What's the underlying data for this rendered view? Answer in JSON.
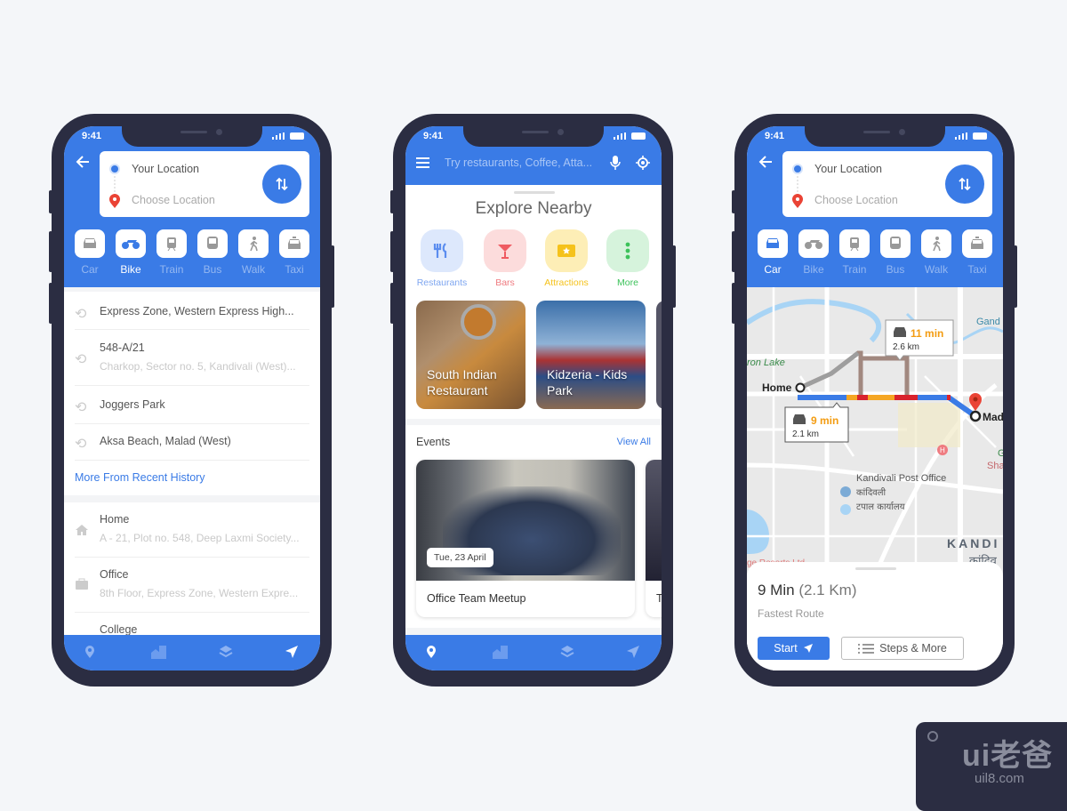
{
  "status": {
    "time": "9:41"
  },
  "colors": {
    "primary": "#3a7be6",
    "frame": "#2b2d42",
    "background": "#f4f6f9",
    "traffic_orange": "#f5a623",
    "traffic_red": "#d9232d",
    "route_alt": "#a1887f"
  },
  "directions": {
    "from": "Your Location",
    "to": "Choose Location",
    "modes": [
      {
        "label": "Car",
        "icon": "car-icon"
      },
      {
        "label": "Bike",
        "icon": "motorbike-icon"
      },
      {
        "label": "Train",
        "icon": "train-icon"
      },
      {
        "label": "Bus",
        "icon": "bus-icon"
      },
      {
        "label": "Walk",
        "icon": "walk-icon"
      },
      {
        "label": "Taxi",
        "icon": "taxi-icon"
      }
    ]
  },
  "history": {
    "items": [
      {
        "title": "Express Zone, Western Express High..."
      },
      {
        "title": "548-A/21",
        "subtitle": "Charkop, Sector no. 5, Kandivali (West)..."
      },
      {
        "title": "Joggers Park"
      },
      {
        "title": "Aksa Beach, Malad (West)"
      }
    ],
    "more_link": "More From Recent History"
  },
  "saved": [
    {
      "title": "Home",
      "subtitle": "A - 21, Plot no. 548, Deep Laxmi Society...",
      "icon": "home-icon"
    },
    {
      "title": "Office",
      "subtitle": "8th Floor, Express Zone, Western Expre...",
      "icon": "briefcase-icon"
    },
    {
      "title": "College"
    }
  ],
  "explore": {
    "search_placeholder": "Try restaurants, Coffee, Atta...",
    "title": "Explore Nearby",
    "categories": [
      {
        "label": "Restaurants",
        "color": "#5b8def",
        "bg": "#dde8fc"
      },
      {
        "label": "Bars",
        "color": "#ef5b62",
        "bg": "#fcdcdc"
      },
      {
        "label": "Attractions",
        "color": "#f5c21b",
        "bg": "#fdeeb6"
      },
      {
        "label": "More",
        "color": "#3cc25a",
        "bg": "#d6f3dc"
      }
    ],
    "places": [
      "South Indian Restaurant",
      "Kidzeria - Kids Park"
    ],
    "events_title": "Events",
    "view_all": "View All",
    "events": [
      {
        "date": "Tue, 23 April",
        "title": "Office Team Meetup"
      },
      {
        "title": "T"
      }
    ]
  },
  "route": {
    "map_labels": {
      "home": "Home",
      "destination": "Mad",
      "lake": "ron Lake",
      "gand": "Gand",
      "post_office": "Kandivali Post Office",
      "post_office_hi1": "कांदिवली",
      "post_office_hi2": "टपाल कार्यालय",
      "area": "KANDI",
      "area_hi": "कांदिव",
      "resort": "ge Resorts Ltd",
      "hospital": "H",
      "sha": "Sha",
      "g": "G"
    },
    "fast": {
      "time": "9 min",
      "distance": "2.1 km"
    },
    "alt": {
      "time": "11 min",
      "distance": "2.6 km"
    },
    "summary_time": "9 Min",
    "summary_distance": "(2.1 Km)",
    "summary_note": "Fastest Route",
    "start": "Start",
    "steps": "Steps & More"
  },
  "logo": {
    "text": "ui老爸",
    "url": "uil8.com"
  }
}
